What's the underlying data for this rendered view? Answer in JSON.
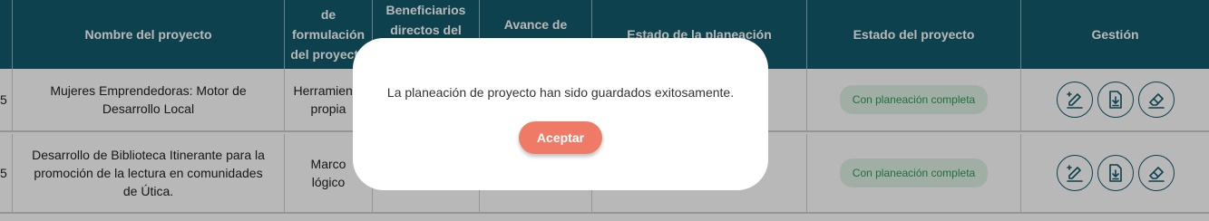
{
  "table": {
    "headers": {
      "nombre": "Nombre del proyecto",
      "formulacion": "de formulación del proyecto",
      "beneficiarios": "Beneficiarios directos del",
      "avance": "Avance de diligenciamiento",
      "estado_planeacion": "Estado de la planeación",
      "estado_proyecto": "Estado del proyecto",
      "gestion": "Gestión"
    },
    "rows": [
      {
        "index_fragment": "5",
        "nombre": "Mujeres Emprendedoras: Motor de Desarrollo Local",
        "formulacion": "Herramienta propia",
        "estado_proyecto": "Con planeación completa"
      },
      {
        "index_fragment": "5",
        "nombre": "Desarrollo de Biblioteca Itinerante para la promoción de la lectura en comunidades de Útica.",
        "formulacion": "Marco lógico",
        "estado_proyecto": "Con planeación completa"
      }
    ],
    "actions": {
      "edit_icon": "edit-plus-icon",
      "download_icon": "file-download-icon",
      "erase_icon": "eraser-icon"
    }
  },
  "modal": {
    "message": "La planeación de proyecto han sido guardados exitosamente.",
    "accept_label": "Aceptar"
  },
  "colors": {
    "header_bg": "#135a6d",
    "badge_bg": "#dff2e5",
    "badge_text": "#2e9a57",
    "accent_button": "#ef7b66"
  }
}
